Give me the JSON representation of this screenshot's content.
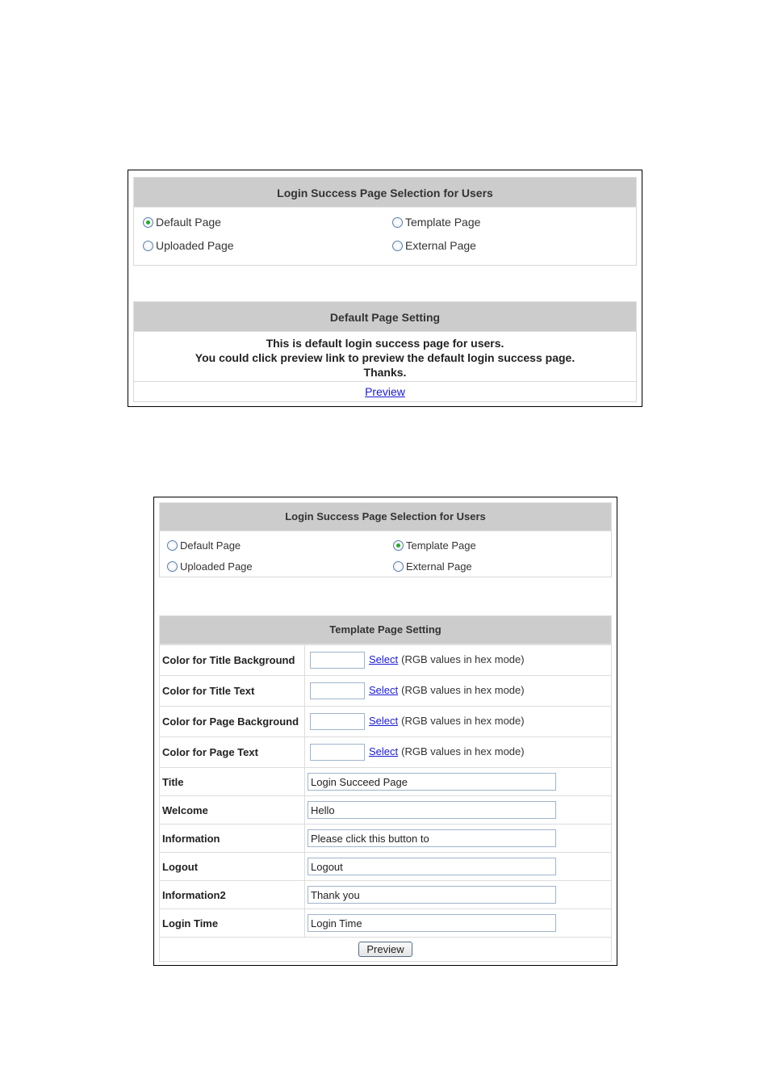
{
  "panel1": {
    "selection_header": "Login Success Page Selection for Users",
    "options": [
      {
        "label": "Default Page",
        "checked": true
      },
      {
        "label": "Template Page",
        "checked": false
      },
      {
        "label": "Uploaded Page",
        "checked": false
      },
      {
        "label": "External Page",
        "checked": false
      }
    ],
    "setting_header": "Default Page Setting",
    "message_lines": [
      "This is default login success page for users.",
      "You could click preview link to preview the default login success page.",
      "Thanks."
    ],
    "preview_link": "Preview"
  },
  "panel2": {
    "selection_header": "Login Success Page Selection for Users",
    "options": [
      {
        "label": "Default Page",
        "checked": false
      },
      {
        "label": "Template Page",
        "checked": true
      },
      {
        "label": "Uploaded Page",
        "checked": false
      },
      {
        "label": "External Page",
        "checked": false
      }
    ],
    "setting_header": "Template Page Setting",
    "color_rows": [
      {
        "label": "Color for Title Background",
        "value": "",
        "select_link": "Select",
        "hint": "(RGB values in hex mode)"
      },
      {
        "label": "Color for Title Text",
        "value": "",
        "select_link": "Select",
        "hint": "(RGB values in hex mode)"
      },
      {
        "label": "Color for Page Background",
        "value": "",
        "select_link": "Select",
        "hint": "(RGB values in hex mode)"
      },
      {
        "label": "Color for Page Text",
        "value": "",
        "select_link": "Select",
        "hint": "(RGB values in hex mode)"
      }
    ],
    "text_rows": [
      {
        "label": "Title",
        "value": "Login Succeed Page"
      },
      {
        "label": "Welcome",
        "value": "Hello"
      },
      {
        "label": "Information",
        "value": "Please click this button to"
      },
      {
        "label": "Logout",
        "value": "Logout"
      },
      {
        "label": "Information2",
        "value": "Thank you"
      },
      {
        "label": "Login Time",
        "value": "Login Time"
      }
    ],
    "preview_button": "Preview"
  }
}
